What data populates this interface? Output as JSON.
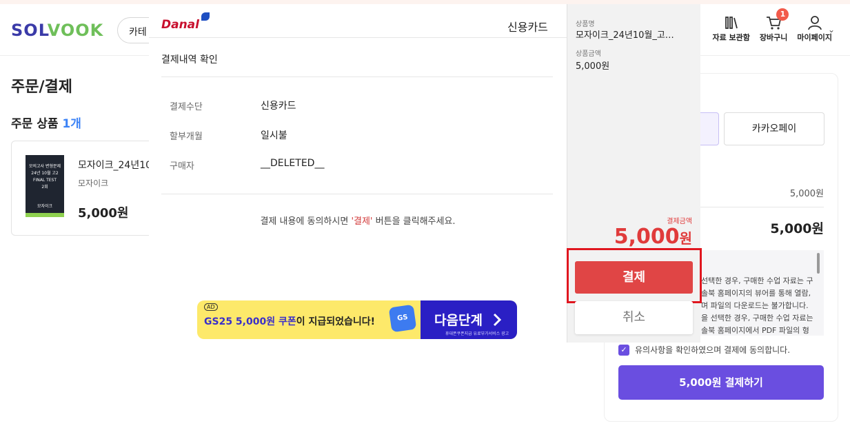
{
  "site": {
    "logo": {
      "left": "SOL",
      "v": "V",
      "right": "OOK"
    },
    "category_partial": "카테"
  },
  "header": {
    "items": [
      {
        "label": "자료 보관함",
        "icon": "archive-icon"
      },
      {
        "label": "장바구니",
        "icon": "cart-icon",
        "badge": "1"
      },
      {
        "label": "마이페이지",
        "icon": "user-icon"
      }
    ]
  },
  "page": {
    "title": "주문/결제",
    "order_heading": "주문 상품",
    "order_count": "1개",
    "product": {
      "cover_lines": [
        "모의고사 변형문제",
        "24년 10월 고2",
        "FINAL TEST",
        "2회",
        "모자이크"
      ],
      "name": "모자이크_24년10",
      "brand": "모자이크",
      "price": "5,000원"
    }
  },
  "summary": {
    "pay_option_2": "카카오페이",
    "subtotal": "5,000원",
    "total": "5,000원",
    "notice_lines": [
      "선택한 경우, 구매한 수업 자료는 구",
      "솔북 홈페이지의 뷰어를 통해 열람,",
      "며 파일의 다운로드는 불가합니다.",
      "을 선택한 경우, 구매한 수업 자료는",
      "솔북 홈페이지에서 PDF 파일의 형"
    ],
    "agree_text": "유의사항을 확인하였으며 결제에 동의합니다.",
    "pay_button": "5,000원 결제하기"
  },
  "danal": {
    "logo": "Danal",
    "method_title": "신용카드",
    "section_title": "결제내역 확인",
    "rows": [
      {
        "label": "결제수단",
        "value": "신용카드"
      },
      {
        "label": "할부개월",
        "value": "일시불"
      },
      {
        "label": "구매자",
        "value": "__DELETED__"
      }
    ],
    "consent_pre": "결제 내용에 동의하시면 ",
    "consent_quote": "'결제'",
    "consent_post": " 버튼을 클릭해주세요.",
    "side": {
      "product_label": "상품명",
      "product_value": "모자이크_24년10월_고…",
      "price_label": "상품금액",
      "price_value": "5,000원",
      "amount_label": "결제금액",
      "amount_value": "5,000",
      "amount_unit": "원",
      "pay_button": "결제",
      "cancel_button": "취소"
    },
    "ad": {
      "tag": "AD",
      "msg_highlight": "GS25 5,000원 쿠폰",
      "msg_rest": "이 지급되었습니다!",
      "gs_label": "GS",
      "next_label": "다음단계",
      "note": "휴대폰쿠폰지급 유료부가서비스 광고"
    }
  },
  "colors": {
    "brand_purple": "#6a4ee0",
    "danal_red": "#e04545",
    "highlight_border": "#e0161f"
  }
}
